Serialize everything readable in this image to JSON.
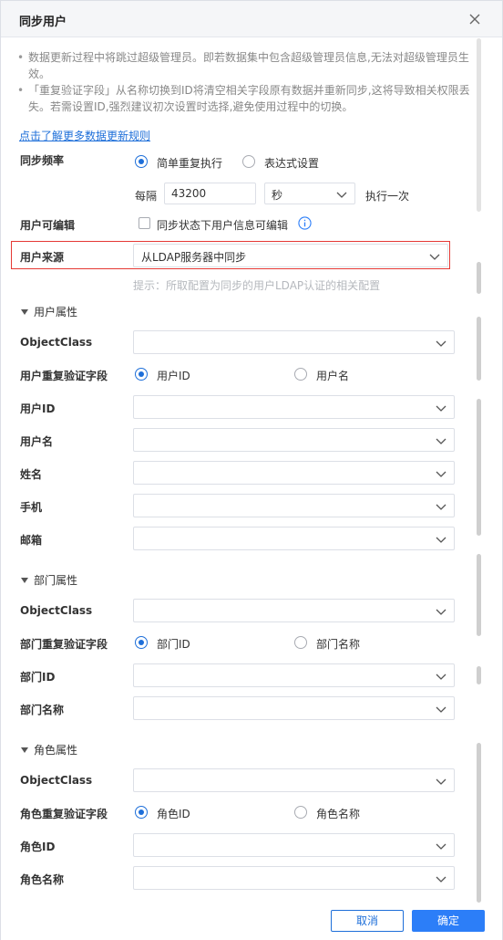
{
  "dialog": {
    "title": "同步用户",
    "close_icon": "close-icon"
  },
  "notice": {
    "line1": "数据更新过程中将跳过超级管理员。即若数据集中包含超级管理员信息,无法对超级管理员生效。",
    "line2": "「重复验证字段」从名称切换到ID将清空相关字段原有数据并重新同步,这将导致相关权限丢失。若需设置ID,强烈建议初次设置时选择,避免使用过程中的切换。"
  },
  "rules_link": "点击了解更多数据更新规则",
  "sync_frequency": {
    "label": "同步频率",
    "option_simple": "简单重复执行",
    "option_expression": "表达式设置",
    "selected": "simple",
    "every_label": "每隔",
    "interval_value": "43200",
    "unit_value": "秒",
    "execute_once": "执行一次"
  },
  "user_editable": {
    "label": "用户可编辑",
    "checkbox_label": "同步状态下用户信息可编辑",
    "checked": false,
    "info_icon": "info-icon"
  },
  "user_source": {
    "label": "用户来源",
    "value": "从LDAP服务器中同步",
    "hint": "提示：所取配置为同步的用户LDAP认证的相关配置",
    "highlight_color": "#e53935"
  },
  "user_attributes": {
    "section_title": "用户属性",
    "objectclass_label": "ObjectClass",
    "dup_field_label": "用户重复验证字段",
    "dup_option_id": "用户ID",
    "dup_option_name": "用户名",
    "dup_selected": "id",
    "user_id_label": "用户ID",
    "username_label": "用户名",
    "fullname_label": "姓名",
    "phone_label": "手机",
    "email_label": "邮箱"
  },
  "dept_attributes": {
    "section_title": "部门属性",
    "objectclass_label": "ObjectClass",
    "dup_field_label": "部门重复验证字段",
    "dup_option_id": "部门ID",
    "dup_option_name": "部门名称",
    "dup_selected": "id",
    "dept_id_label": "部门ID",
    "dept_name_label": "部门名称"
  },
  "role_attributes": {
    "section_title": "角色属性",
    "objectclass_label": "ObjectClass",
    "dup_field_label": "角色重复验证字段",
    "dup_option_id": "角色ID",
    "dup_option_name": "角色名称",
    "dup_selected": "id",
    "role_id_label": "角色ID",
    "role_name_label": "角色名称"
  },
  "footer": {
    "cancel_label": "取消",
    "ok_label": "确定"
  },
  "colors": {
    "primary": "#2c7ef8",
    "link": "#1e6fd9",
    "hint": "#b5b8bd"
  }
}
